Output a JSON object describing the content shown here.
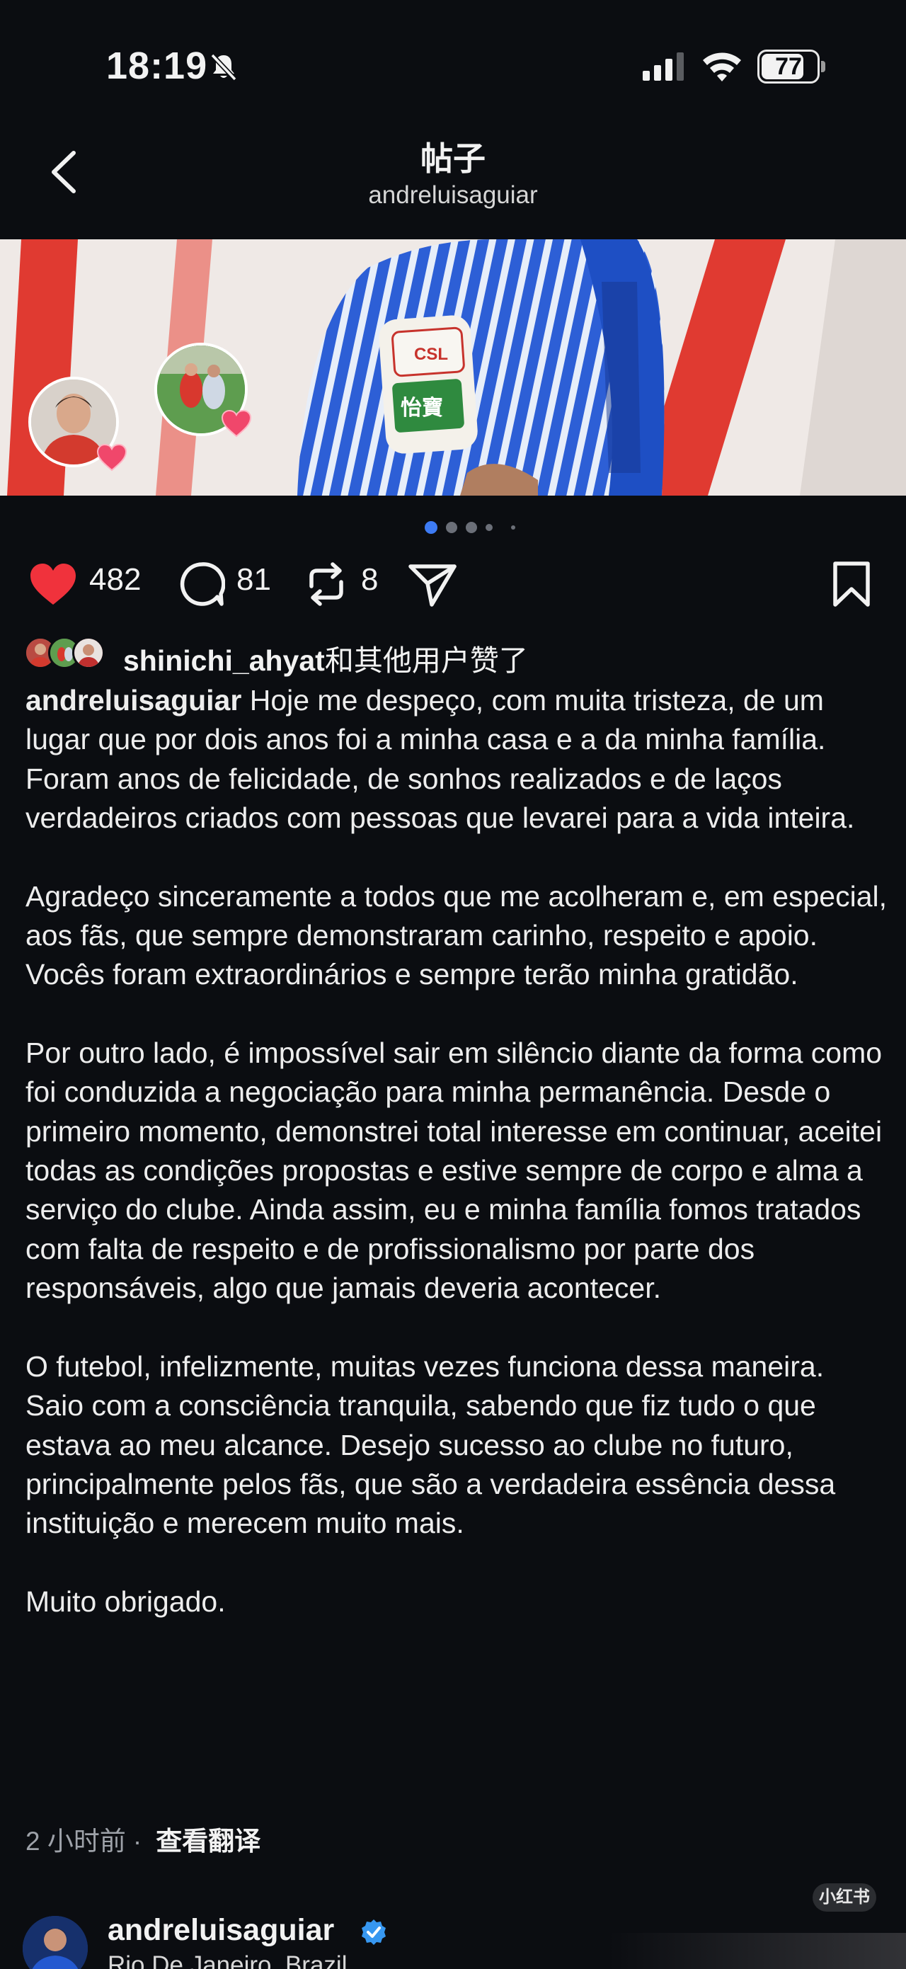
{
  "status": {
    "time": "18:19",
    "battery": "77",
    "battery_level": 0.77
  },
  "header": {
    "title": "帖子",
    "username": "andreluisaguiar"
  },
  "carousel": {
    "total_slides": 5,
    "active_index": 0,
    "patch_text": "CSL",
    "sponsor_text": "怡寶"
  },
  "actions": {
    "likes": "482",
    "comments": "81",
    "reposts": "8"
  },
  "liked_by": {
    "user": "shinichi_ahyat",
    "suffix": "和其他用户赞了"
  },
  "caption": {
    "author": "andreluisaguiar",
    "paragraphs": [
      " Hoje me despeço, com muita tristeza, de um lugar que por dois anos foi a minha casa e a da minha família. Foram anos de felicidade, de sonhos realizados e de laços verdadeiros criados com pessoas que levarei para a vida inteira.",
      "Agradeço sinceramente a todos que me acolheram e, em especial, aos fãs, que sempre demonstraram carinho, respeito e apoio. Vocês foram extraordinários e sempre terão minha gratidão.",
      "Por outro lado, é impossível sair em silêncio diante da forma como foi conduzida a negociação para minha permanência. Desde o primeiro momento, demonstrei total interesse em continuar, aceitei todas as condições propostas e estive sempre de corpo e alma a serviço do clube. Ainda assim, eu e minha família fomos tratados com falta de respeito e de profissionalismo por parte dos responsáveis, algo que jamais deveria acontecer.",
      "O futebol, infelizmente, muitas vezes funciona dessa maneira. Saio com a consciência tranquila, sabendo que fiz tudo o que estava ao meu alcance. Desejo sucesso ao clube no futuro, principalmente pelos fãs, que são a verdadeira essência dessa instituição e merecem muito mais.",
      "Muito obrigado."
    ]
  },
  "meta": {
    "time_ago": "2 小时前",
    "separator": "·",
    "translate": "查看翻译"
  },
  "watermark": "小红书",
  "next_post": {
    "username": "andreluisaguiar",
    "location": "Rio De Janeiro, Brazil"
  },
  "colors": {
    "background": "#0b0d11",
    "like_red": "#f0323c",
    "verified_blue": "#3797f0",
    "active_dot": "#3d7bf4"
  }
}
